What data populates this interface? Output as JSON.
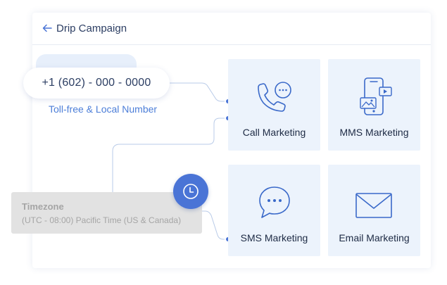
{
  "header": {
    "back_icon": "arrow-left-icon",
    "title": "Drip Campaign"
  },
  "phone": {
    "number": "+1 (602) - 000 - 0000",
    "subtitle": "Toll-free & Local Number"
  },
  "timezone": {
    "label": "Timezone",
    "value": "(UTC - 08:00) Pacific Time (US & Canada)",
    "icon": "clock-icon"
  },
  "channels": [
    {
      "label": "Call Marketing",
      "icon": "phone-chat-icon"
    },
    {
      "label": "MMS Marketing",
      "icon": "mobile-media-icon"
    },
    {
      "label": "SMS Marketing",
      "icon": "chat-bubble-icon"
    },
    {
      "label": "Email Marketing",
      "icon": "envelope-icon"
    }
  ],
  "colors": {
    "accent": "#4a74d6",
    "tile_background": "#ecf3fc",
    "connector": "#b9cbe8",
    "text_dark": "#2c3e63"
  }
}
